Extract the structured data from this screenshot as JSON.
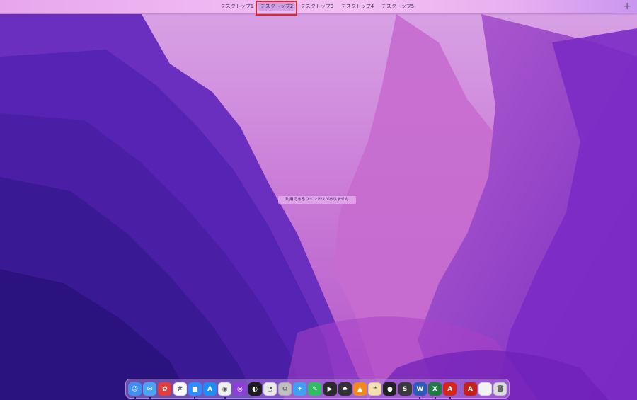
{
  "spaces_bar": {
    "tabs": [
      {
        "label": "デスクトップ1",
        "active": false
      },
      {
        "label": "デスクトップ2",
        "active": true
      },
      {
        "label": "デスクトップ3",
        "active": false
      },
      {
        "label": "デスクトップ4",
        "active": false
      },
      {
        "label": "デスクトップ5",
        "active": false
      }
    ],
    "add_label": "+"
  },
  "desktop": {
    "empty_message": "利用できるウインドウがありません"
  },
  "dock": {
    "apps": [
      {
        "icon": "finder-icon",
        "glyph": "☺",
        "color": "#3d8ff0",
        "running": true
      },
      {
        "icon": "mail-icon",
        "glyph": "✉",
        "color": "#4aa3f5",
        "running": true
      },
      {
        "icon": "photo-booth-icon",
        "glyph": "✿",
        "color": "#e23c3c",
        "running": false
      },
      {
        "icon": "slack-icon",
        "glyph": "#",
        "color": "#ffffff",
        "running": false
      },
      {
        "icon": "zoom-icon",
        "glyph": "■",
        "color": "#2d8cff",
        "running": true
      },
      {
        "icon": "app-store-icon",
        "glyph": "A",
        "color": "#1e8cf0",
        "running": false
      },
      {
        "icon": "chrome-icon",
        "glyph": "◉",
        "color": "#f0f0f0",
        "running": true
      },
      {
        "icon": "podcasts-icon",
        "glyph": "◎",
        "color": "#8e3fd6",
        "running": false
      },
      {
        "icon": "obs-icon",
        "glyph": "◐",
        "color": "#1d1d1d",
        "running": false
      },
      {
        "icon": "cyberduck-icon",
        "glyph": "◔",
        "color": "#eaeaea",
        "running": false
      },
      {
        "icon": "compressor-icon",
        "glyph": "⚙",
        "color": "#bfbfbf",
        "running": false
      },
      {
        "icon": "safari-icon",
        "glyph": "✦",
        "color": "#3f9ff0",
        "running": false
      },
      {
        "icon": "evernote-icon",
        "glyph": "✎",
        "color": "#2dbe60",
        "running": false
      },
      {
        "icon": "final-cut-icon",
        "glyph": "▶",
        "color": "#2a2a2a",
        "running": false
      },
      {
        "icon": "motion-icon",
        "glyph": "✸",
        "color": "#333333",
        "running": false
      },
      {
        "icon": "vlc-icon",
        "glyph": "▲",
        "color": "#f08a1c",
        "running": false
      },
      {
        "icon": "messages-icon",
        "glyph": "❝",
        "color": "#f3e2b0",
        "running": false
      },
      {
        "icon": "logic-icon",
        "glyph": "●",
        "color": "#222222",
        "running": false
      },
      {
        "icon": "sublime-icon",
        "glyph": "S",
        "color": "#3a3a3a",
        "running": false
      },
      {
        "icon": "word-icon",
        "glyph": "W",
        "color": "#2b5bb8",
        "running": true
      },
      {
        "icon": "excel-icon",
        "glyph": "X",
        "color": "#1f7a43",
        "running": true
      },
      {
        "icon": "acrobat-icon",
        "glyph": "A",
        "color": "#d6261c",
        "running": true
      }
    ],
    "docs": [
      {
        "icon": "pdf-document-icon",
        "glyph": "A",
        "color": "#c22218"
      },
      {
        "icon": "blank-document-icon",
        "glyph": "",
        "color": "#f2f2f2"
      },
      {
        "icon": "trash-icon",
        "glyph": "🗑",
        "color": "#dcdcdc"
      }
    ]
  }
}
